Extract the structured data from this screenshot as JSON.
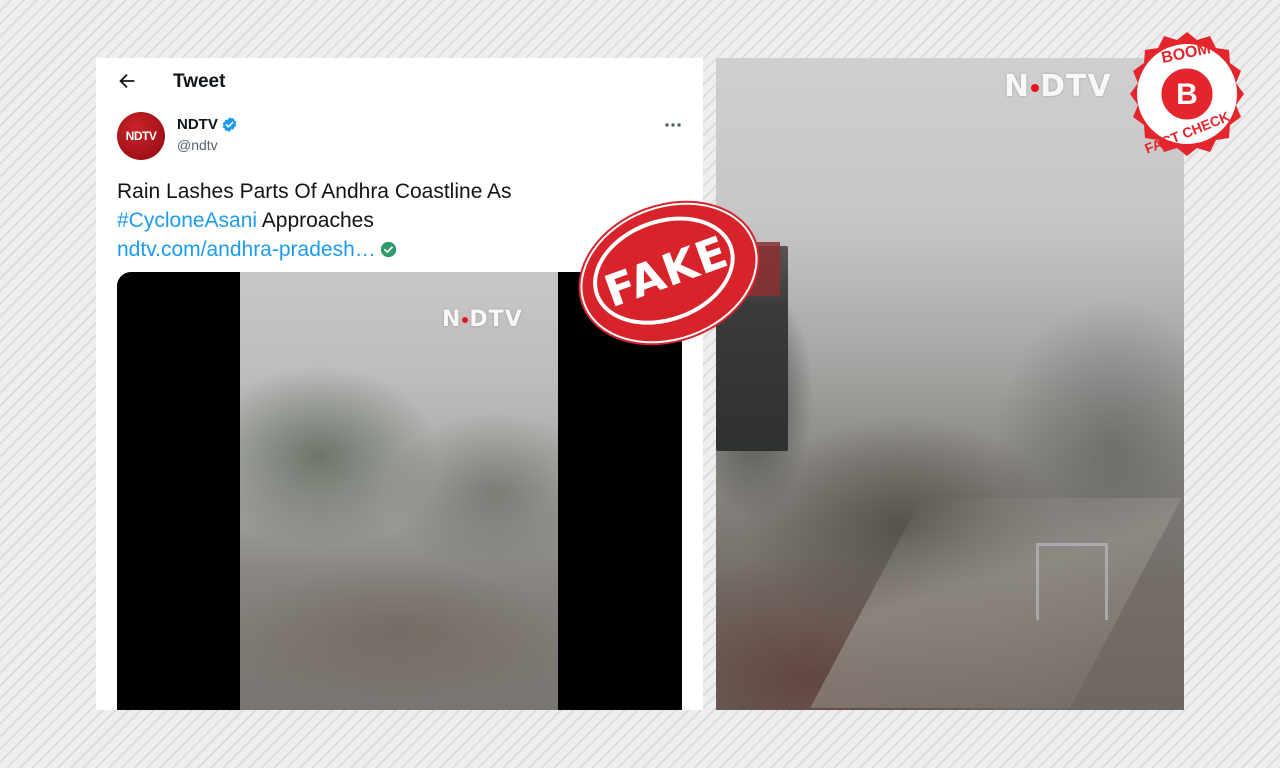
{
  "header": {
    "title": "Tweet"
  },
  "tweet": {
    "author": {
      "avatar_text": "NDTV",
      "name": "NDTV",
      "handle": "@ndtv",
      "verified": true
    },
    "text": {
      "line1": "Rain Lashes Parts Of Andhra Coastline As",
      "hashtag": "#CycloneAsani",
      "line2_rest": " Approaches",
      "link": "ndtv.com/andhra-pradesh…"
    },
    "media": {
      "watermark": "NDTV"
    }
  },
  "video_panel": {
    "watermark": "NDTV"
  },
  "stamp": {
    "label": "FAKE",
    "color": "#d8232a"
  },
  "boom_logo": {
    "top_text": "BOOM",
    "center_letter": "B",
    "bottom_text": "FACT CHECK",
    "color": "#e4252c"
  },
  "colors": {
    "link": "#1d9bf0",
    "verified": "#1d9bf0",
    "avatar": "#b41a20"
  },
  "icons": {
    "back": "arrow-left-icon",
    "verified": "verified-badge-icon",
    "more": "more-horizontal-icon",
    "link_check": "check-circle-icon"
  }
}
